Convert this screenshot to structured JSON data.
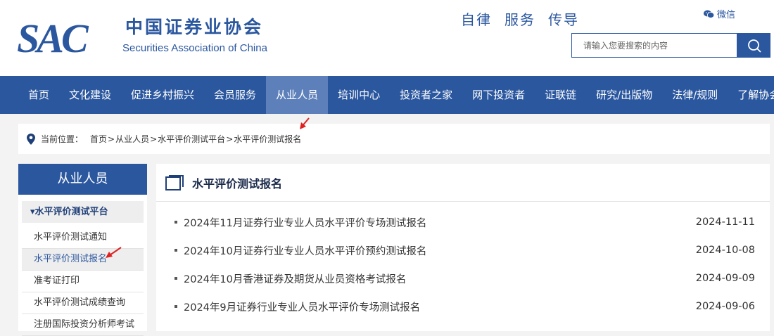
{
  "header": {
    "logo_letters": "SAC",
    "logo_cn": "中国证券业协会",
    "logo_en": "Securities Association of China",
    "slogan": [
      "自律",
      "服务",
      "传导"
    ],
    "wechat_label": "微信",
    "search_placeholder": "请输入您要搜索的内容"
  },
  "nav": {
    "items": [
      {
        "label": "首页"
      },
      {
        "label": "文化建设"
      },
      {
        "label": "促进乡村振兴"
      },
      {
        "label": "会员服务"
      },
      {
        "label": "从业人员",
        "active": true
      },
      {
        "label": "培训中心"
      },
      {
        "label": "投资者之家"
      },
      {
        "label": "网下投资者"
      },
      {
        "label": "证联链"
      },
      {
        "label": "研究/出版物"
      },
      {
        "label": "法律/规则"
      },
      {
        "label": "了解协会"
      }
    ]
  },
  "breadcrumb": {
    "label": "当前位置：",
    "items": [
      "首页",
      "从业人员",
      "水平评价测试平台",
      "水平评价测试报名"
    ],
    "separator": ">"
  },
  "sidebar": {
    "title": "从业人员",
    "group": "▾水平评价测试平台",
    "items": [
      {
        "label": "水平评价测试通知"
      },
      {
        "label": "水平评价测试报名",
        "active": true
      },
      {
        "label": "准考证打印"
      },
      {
        "label": "水平评价测试成绩查询"
      },
      {
        "label": "注册国际投资分析师考试"
      }
    ]
  },
  "content": {
    "title": "水平评价测试报名",
    "rows": [
      {
        "title": "2024年11月证券行业专业人员水平评价专场测试报名",
        "date": "2024-11-11"
      },
      {
        "title": "2024年10月证券行业专业人员水平评价预约测试报名",
        "date": "2024-10-08"
      },
      {
        "title": "2024年10月香港证券及期货从业员资格考试报名",
        "date": "2024-09-09"
      },
      {
        "title": "2024年9月证券行业专业人员水平评价专场测试报名",
        "date": "2024-09-06"
      }
    ]
  },
  "colors": {
    "brand": "#2b579f",
    "nav_active": "#5d80ba",
    "annotation_arrow": "#e02020"
  }
}
